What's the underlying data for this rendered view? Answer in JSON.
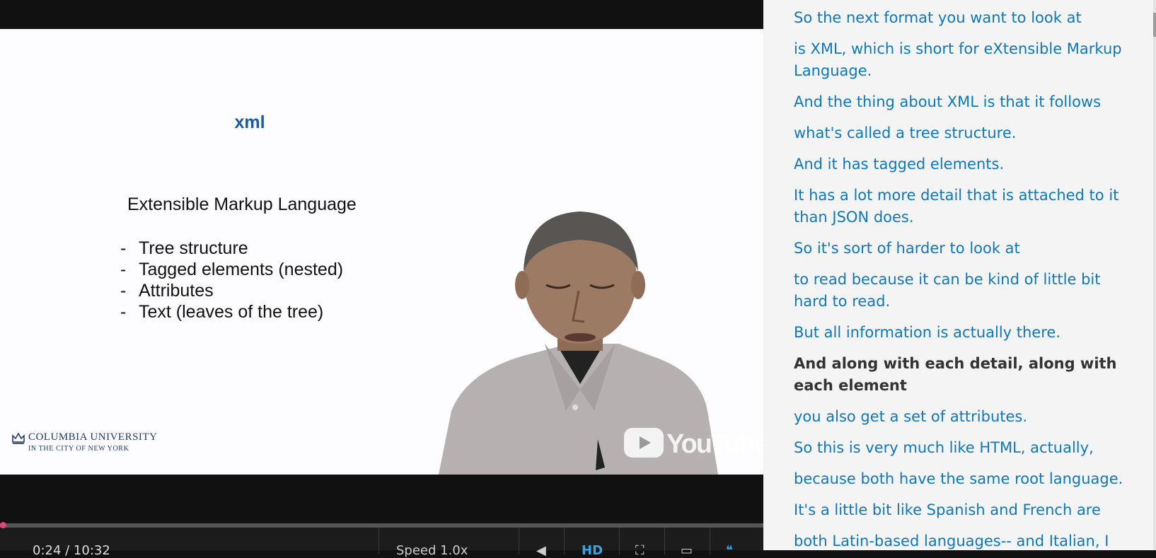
{
  "player": {
    "slide": {
      "title": "xml",
      "subtitle": "Extensible Markup Language",
      "bullets": [
        "Tree structure",
        "Tagged elements (nested)",
        "Attributes",
        "Text (leaves of the tree)"
      ],
      "logo_line1": "COLUMBIA UNIVERSITY",
      "logo_line2": "IN THE CITY OF NEW YORK"
    },
    "watermark": "YouTube",
    "controls": {
      "time": "0:24 / 10:32",
      "speed": "Speed 1.0x",
      "hd": "HD",
      "progress_percent": 0.4
    }
  },
  "transcript": {
    "lines": [
      {
        "text": "So the next format you want to look at",
        "active": false
      },
      {
        "text": "is XML, which is short for eXtensible Markup Language.",
        "active": false
      },
      {
        "text": "And the thing about XML is that it follows",
        "active": false
      },
      {
        "text": "what's called a tree structure.",
        "active": false
      },
      {
        "text": "And it has tagged elements.",
        "active": false
      },
      {
        "text": "It has a lot more detail that is attached to it than JSON does.",
        "active": false
      },
      {
        "text": "So it's sort of harder to look at",
        "active": false
      },
      {
        "text": "to read because it can be kind of little bit hard to read.",
        "active": false
      },
      {
        "text": "But all information is actually there.",
        "active": false
      },
      {
        "text": "And along with each detail, along with each element",
        "active": true
      },
      {
        "text": "you also get a set of attributes.",
        "active": false
      },
      {
        "text": "So this is very much like HTML, actually,",
        "active": false
      },
      {
        "text": "because both have the same root language.",
        "active": false
      },
      {
        "text": "It's a little bit like Spanish and French are",
        "active": false
      },
      {
        "text": "both Latin-based languages-- and Italian, I",
        "active": false
      }
    ]
  },
  "colors": {
    "link": "#0f77ba",
    "active_text": "#333333",
    "slide_title": "#1a5aa8",
    "progress": "#c3306e"
  }
}
